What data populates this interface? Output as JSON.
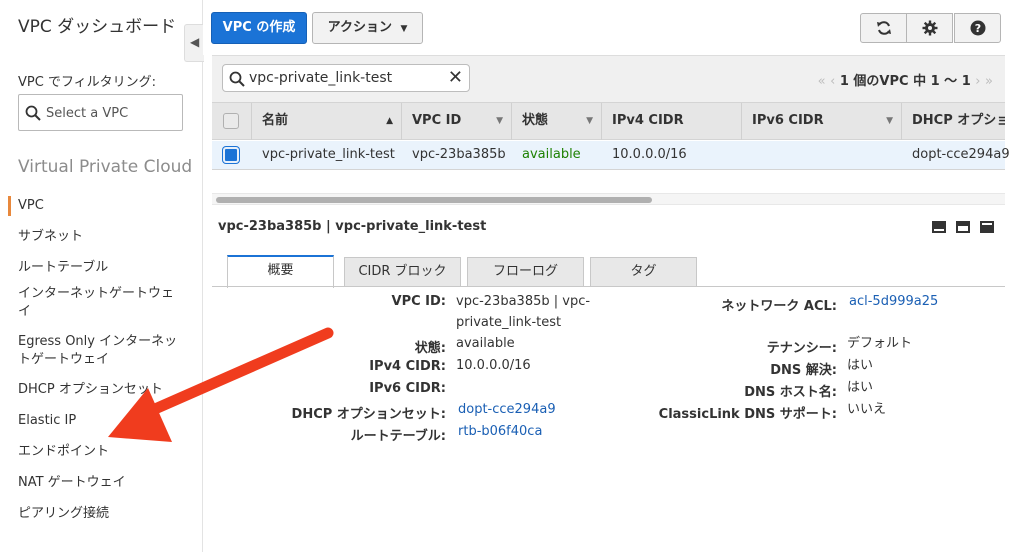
{
  "sidebar": {
    "title": "VPC ダッシュボード",
    "filter_label": "VPC でフィルタリング:",
    "vpc_select_placeholder": "Select a VPC",
    "section_title": "Virtual Private Cloud",
    "items": [
      {
        "label": "VPC"
      },
      {
        "label": "サブネット"
      },
      {
        "label": "ルートテーブル"
      },
      {
        "label": "インターネットゲートウェイ"
      },
      {
        "label": "Egress Only インターネットゲートウェイ"
      },
      {
        "label": "DHCP オプションセット"
      },
      {
        "label": "Elastic IP"
      },
      {
        "label": "エンドポイント"
      },
      {
        "label": "NAT ゲートウェイ"
      },
      {
        "label": "ピアリング接続"
      }
    ]
  },
  "toolbar": {
    "create_label": "VPC の作成",
    "actions_label": "アクション",
    "refresh_icon": "refresh-icon",
    "settings_icon": "gear-icon",
    "help_icon": "help-icon"
  },
  "grid": {
    "search_value": "vpc-private_link-test",
    "pager_text": "1 個のVPC 中 1 ～ 1",
    "columns": [
      "名前",
      "VPC ID",
      "状態",
      "IPv4 CIDR",
      "IPv6 CIDR",
      "DHCP オプショ"
    ],
    "rows": [
      {
        "name": "vpc-private_link-test",
        "vpc_id": "vpc-23ba385b",
        "state": "available",
        "ipv4_cidr": "10.0.0.0/16",
        "ipv6_cidr": "",
        "dhcp": "dopt-cce294a9"
      }
    ]
  },
  "details": {
    "title": "vpc-23ba385b | vpc-private_link-test",
    "tabs": [
      "概要",
      "CIDR ブロック",
      "フローログ",
      "タグ"
    ],
    "left": {
      "vpc_id_label": "VPC ID:",
      "vpc_id_value_line1": "vpc-23ba385b | vpc-",
      "vpc_id_value_line2": "private_link-test",
      "state_label": "状態:",
      "state_value": "available",
      "ipv4_label": "IPv4 CIDR:",
      "ipv4_value": "10.0.0.0/16",
      "ipv6_label": "IPv6 CIDR:",
      "ipv6_value": "",
      "dhcp_label": "DHCP オプションセット:",
      "dhcp_value": "dopt-cce294a9",
      "route_label": "ルートテーブル:",
      "route_value": "rtb-b06f40ca"
    },
    "right": {
      "acl_label": "ネットワーク ACL:",
      "acl_value": "acl-5d999a25",
      "tenancy_label": "テナンシー:",
      "tenancy_value": "デフォルト",
      "dns_res_label": "DNS 解決:",
      "dns_res_value": "はい",
      "dns_host_label": "DNS ホスト名:",
      "dns_host_value": "はい",
      "classiclink_label": "ClassicLink DNS サポート:",
      "classiclink_value": "いいえ"
    }
  },
  "colors": {
    "primary": "#1b73d6",
    "active_nav": "#e8883c",
    "available": "#1d8102",
    "link": "#1a5fb4",
    "arrow": "#f03c1e"
  }
}
